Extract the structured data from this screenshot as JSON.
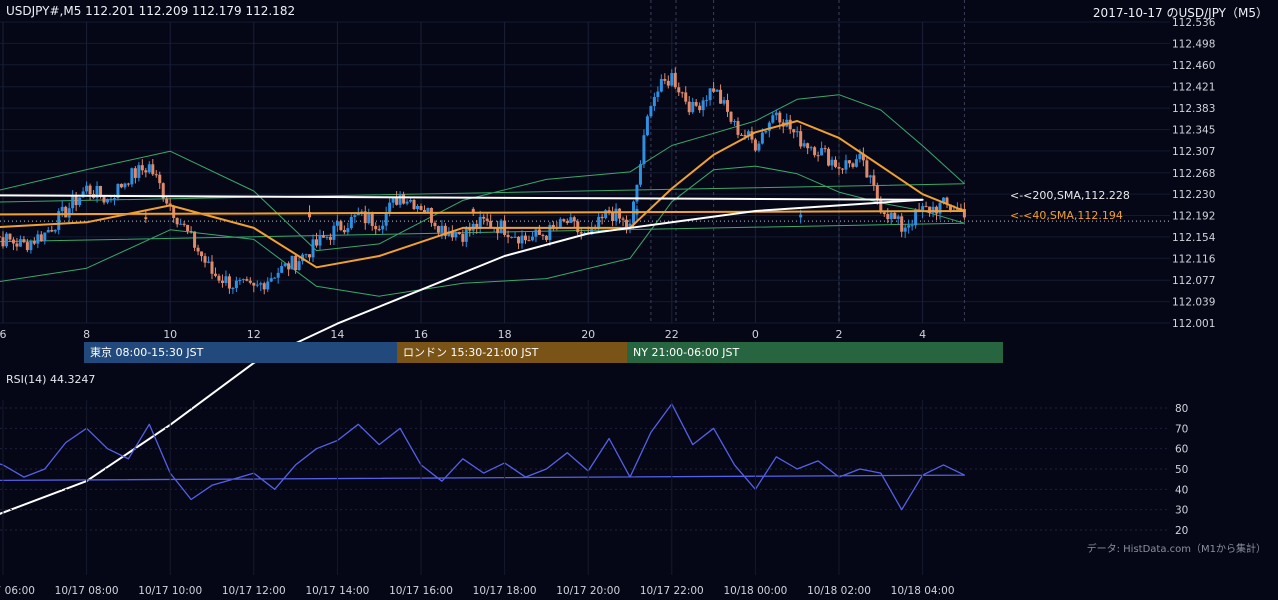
{
  "header": {
    "symbol_ohlc": "USDJPY#,M5 112.201 112.209 112.179 112.182",
    "date_title": "2017-10-17 のUSD/JPY（M5）"
  },
  "indicators": {
    "sma200_label": "<-<200,SMA,112.228",
    "sma40_label": "<-<40,SMA,112.194",
    "rsi_label": "RSI(14) 44.3247"
  },
  "sessions": [
    {
      "label": "東京 08:00-15:30 JST",
      "color": "#22497b"
    },
    {
      "label": "ロンドン 15:30-21:00 JST",
      "color": "#7a5417"
    },
    {
      "label": "NY 21:00-06:00 JST",
      "color": "#276440"
    }
  ],
  "source_note": "データ: HistData.com（M1から集計）",
  "colors": {
    "background": "#050716",
    "up_candle": "#2f8fe0",
    "down_candle": "#e08a6c",
    "sma40": "#f0a030",
    "sma200": "#ffffff",
    "bollinger": "#3aa86a",
    "rsi": "#5560e6"
  },
  "chart_data": [
    {
      "type": "candlestick",
      "title": "USD/JPY M5",
      "x_tick_labels": [
        "6",
        "8",
        "10",
        "12",
        "14",
        "16",
        "18",
        "20",
        "22",
        "0",
        "2",
        "4"
      ],
      "y_tick_labels": [
        "112.536",
        "112.498",
        "112.460",
        "112.421",
        "112.383",
        "112.345",
        "112.307",
        "112.268",
        "112.230",
        "112.192",
        "112.154",
        "112.116",
        "112.077",
        "112.039",
        "112.001"
      ],
      "ylim": [
        112.001,
        112.536
      ],
      "current_price": 112.182,
      "series": [
        {
          "name": "close",
          "x": [
            5.5,
            6.0,
            6.5,
            7.0,
            7.5,
            8.0,
            8.5,
            9.0,
            9.5,
            10.0,
            10.5,
            11.0,
            11.5,
            12.0,
            12.5,
            13.0,
            13.5,
            14.0,
            14.5,
            15.0,
            15.5,
            16.0,
            16.5,
            17.0,
            17.5,
            18.0,
            18.5,
            19.0,
            19.5,
            20.0,
            20.5,
            21.0,
            21.5,
            22.0,
            22.5,
            23.0,
            23.5,
            0.0,
            0.5,
            1.0,
            1.5,
            2.0,
            2.5,
            3.0,
            3.5,
            4.0,
            4.5,
            5.0,
            5.5
          ],
          "values": [
            112.17,
            112.15,
            112.14,
            112.16,
            112.2,
            112.24,
            112.22,
            112.26,
            112.28,
            112.21,
            112.15,
            112.09,
            112.07,
            112.06,
            112.09,
            112.11,
            112.14,
            112.17,
            112.19,
            112.18,
            112.23,
            112.21,
            112.17,
            112.16,
            112.18,
            112.17,
            112.15,
            112.16,
            112.18,
            112.15,
            112.2,
            112.17,
            112.4,
            112.44,
            112.38,
            112.42,
            112.35,
            112.32,
            112.38,
            112.33,
            112.31,
            112.28,
            112.29,
            112.21,
            112.17,
            112.2,
            112.21,
            112.2,
            112.182
          ]
        },
        {
          "name": "SMA 40",
          "x": [
            5.5,
            8.0,
            10.0,
            12.0,
            13.5,
            15.0,
            17.0,
            19.0,
            21.0,
            22.0,
            23.0,
            0.0,
            1.0,
            2.0,
            3.0,
            4.0,
            5.0,
            5.5
          ],
          "values": [
            112.17,
            112.18,
            112.21,
            112.17,
            112.1,
            112.12,
            112.17,
            112.17,
            112.17,
            112.24,
            112.3,
            112.34,
            112.36,
            112.33,
            112.28,
            112.23,
            112.2,
            112.194
          ]
        },
        {
          "name": "SMA 200",
          "x": [
            5.5,
            8.0,
            10.0,
            12.0,
            14.0,
            16.0,
            18.0,
            20.0,
            22.0,
            0.0,
            2.0,
            4.0,
            5.5
          ],
          "values": [
            111.65,
            111.72,
            111.82,
            111.93,
            112.0,
            112.06,
            112.12,
            112.16,
            112.18,
            112.2,
            112.21,
            112.22,
            112.228
          ]
        }
      ]
    },
    {
      "type": "line",
      "title": "RSI(14)",
      "x_tick_labels": [
        "10/17 06:00",
        "10/17 08:00",
        "10/17 10:00",
        "10/17 12:00",
        "10/17 14:00",
        "10/17 16:00",
        "10/17 18:00",
        "10/17 20:00",
        "10/17 22:00",
        "10/18 00:00",
        "10/18 02:00",
        "10/18 04:00"
      ],
      "y_tick_labels": [
        "80",
        "70",
        "60",
        "50",
        "40",
        "30",
        "20"
      ],
      "ylim": [
        20,
        80
      ],
      "series": [
        {
          "name": "RSI",
          "x": [
            5.5,
            6.0,
            6.5,
            7.0,
            7.5,
            8.0,
            8.5,
            9.0,
            9.5,
            10.0,
            10.5,
            11.0,
            11.5,
            12.0,
            12.5,
            13.0,
            13.5,
            14.0,
            14.5,
            15.0,
            15.5,
            16.0,
            16.5,
            17.0,
            17.5,
            18.0,
            18.5,
            19.0,
            19.5,
            20.0,
            20.5,
            21.0,
            21.5,
            22.0,
            22.5,
            23.0,
            23.5,
            0.0,
            0.5,
            1.0,
            1.5,
            2.0,
            2.5,
            3.0,
            3.5,
            4.0,
            4.5,
            5.0,
            5.5
          ],
          "values": [
            55,
            52,
            46,
            50,
            63,
            70,
            60,
            55,
            72,
            48,
            35,
            42,
            45,
            48,
            40,
            52,
            60,
            64,
            72,
            62,
            70,
            52,
            44,
            55,
            48,
            53,
            46,
            50,
            58,
            49,
            65,
            46,
            68,
            82,
            62,
            70,
            52,
            40,
            56,
            50,
            54,
            46,
            50,
            48,
            30,
            47,
            52,
            47,
            44.3247
          ]
        }
      ]
    }
  ]
}
